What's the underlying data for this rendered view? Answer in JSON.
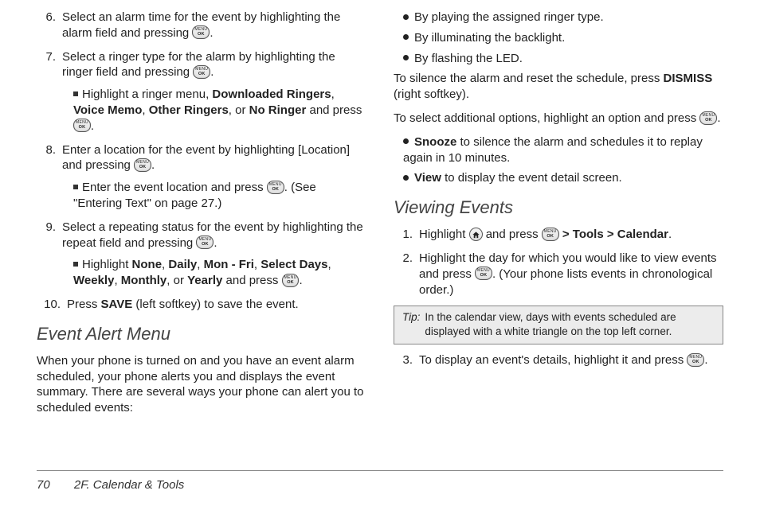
{
  "footer": {
    "pageNum": "70",
    "section": "2F. Calendar & Tools"
  },
  "keyLabel": {
    "top": "MENU",
    "bot": "OK"
  },
  "col1": {
    "list": [
      {
        "n": "6.",
        "pre": "Select an alarm time for the event by highlighting the alarm field and pressing ",
        "post": "."
      },
      {
        "n": "7.",
        "pre": "Select a ringer type for the alarm by highlighting the ringer field and pressing ",
        "post": ".",
        "sub": {
          "a": "Highlight a ringer menu, ",
          "b1": "Downloaded Ringers",
          "c1": ", ",
          "b2": "Voice Memo",
          "c2": ", ",
          "b3": "Other Ringers",
          "c3": ", or ",
          "b4": "No Ringer",
          "c4": " and press ",
          "post": "."
        }
      },
      {
        "n": "8.",
        "pre": "Enter a location for the event by highlighting [Location] and pressing ",
        "post": ".",
        "sub": {
          "a": "Enter the event location and press ",
          "post": ". (See \"Entering Text\" on page 27.)"
        }
      },
      {
        "n": "9.",
        "pre": "Select a repeating status for the event by highlighting the repeat field and pressing ",
        "post": ".",
        "sub": {
          "a": "Highlight ",
          "b1": "None",
          "c1": ", ",
          "b2": "Daily",
          "c2": ", ",
          "b3": "Mon - Fri",
          "c3": ", ",
          "b4": "Select Days",
          "c4": ", ",
          "b5": "Weekly",
          "c5": ", ",
          "b6": "Monthly",
          "c6": ", or ",
          "b7": "Yearly",
          "c7": " and press ",
          "post": "."
        }
      },
      {
        "n": "10.",
        "pre": "Press ",
        "b": "SAVE",
        "post": " (left softkey) to save the event."
      }
    ],
    "h2": "Event Alert Menu",
    "para": "When your phone is turned on and you have an event alarm scheduled, your phone alerts you and displays the event summary. There are several ways your phone can alert you to scheduled events:"
  },
  "col2": {
    "bullets": [
      "By playing the assigned ringer type.",
      "By illuminating the backlight.",
      "By flashing the LED."
    ],
    "p1a": "To silence the alarm and reset the schedule, press ",
    "p1b": "DISMISS",
    "p1c": " (right softkey).",
    "p2a": "To select additional options, highlight an option and press ",
    "p2b": ".",
    "opt1a": "Snooze",
    "opt1b": " to silence the alarm and schedules it to replay again in 10 minutes.",
    "opt2a": "View",
    "opt2b": " to display the event detail screen.",
    "h2": "Viewing Events",
    "s1a": "Highlight ",
    "s1b": " and press ",
    "s1c": " ",
    "s1d": "Tools",
    "s1e": "Calendar",
    "s1f": ".",
    "s2a": "Highlight the day for which you would like to view events and press ",
    "s2b": ". (Your phone lists events in chronological order.)",
    "tipLabel": "Tip:",
    "tipText": "In the calendar view, days with events scheduled are displayed with a white triangle on the top left corner.",
    "s3a": "To display an event's details, highlight it and press ",
    "s3b": "."
  }
}
